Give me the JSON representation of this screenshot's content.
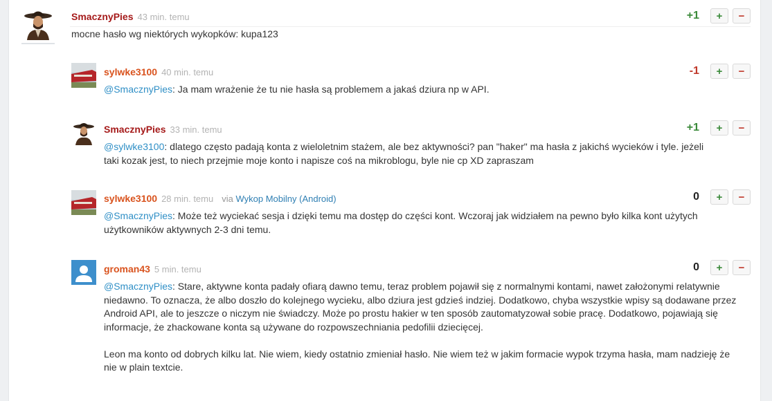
{
  "entry": {
    "author": "SmacznyPies",
    "time": "43 min. temu",
    "score": "+1",
    "text": "mocne hasło wg niektórych wykopków: kupa123",
    "plus_label": "+",
    "minus_label": "−"
  },
  "comments": [
    {
      "author": "sylwke3100",
      "time": "40 min. temu",
      "score": "-1",
      "mention": "@SmacznyPies",
      "text": ": Ja mam wrażenie że tu nie hasła są problemem a jakaś dziura np w API.",
      "plus_label": "+",
      "minus_label": "−"
    },
    {
      "author": "SmacznyPies",
      "time": "33 min. temu",
      "score": "+1",
      "mention": "@sylwke3100",
      "text": ": dlatego często padają konta z wieloletnim stażem, ale bez aktywności? pan \"haker\" ma hasła z jakichś wycieków i tyle. jeżeli taki kozak jest, to niech przejmie moje konto i napisze coś na mikroblogu, byle nie cp XD zapraszam",
      "plus_label": "+",
      "minus_label": "−"
    },
    {
      "author": "sylwke3100",
      "time": "28 min. temu",
      "via_prefix": "via",
      "via_app": "Wykop Mobilny (Android)",
      "score": "0",
      "mention": "@SmacznyPies",
      "text": ": Może też wyciekać sesja i dzięki temu ma dostęp do części kont. Wczoraj jak widziałem na pewno było kilka kont użytych użytkowników aktywnych 2-3 dni temu.",
      "plus_label": "+",
      "minus_label": "−"
    },
    {
      "author": "groman43",
      "time": "5 min. temu",
      "score": "0",
      "mention": "@SmacznyPies",
      "text": ": Stare, aktywne konta padały ofiarą dawno temu, teraz problem pojawił się z normalnymi kontami, nawet założonymi relatywnie niedawno. To oznacza, że albo doszło do kolejnego wycieku, albo dziura jest gdzieś indziej. Dodatkowo, chyba wszystkie wpisy są dodawane przez Android API, ale to jeszcze o niczym nie świadczy. Może po prostu hakier w ten sposób zautomatyzował sobie pracę. Dodatkowo, pojawiają się informacje, że zhackowane konta są używane do rozpowszechniania pedofilii dziecięcej.",
      "text2": "Leon ma konto od dobrych kilku lat. Nie wiem, kiedy ostatnio zmieniał hasło. Nie wiem też w jakim formacie wypok trzyma hasła, mam nadzieję że nie w plain textcie.",
      "plus_label": "+",
      "minus_label": "−"
    }
  ],
  "colors": {
    "author_red": "#a51a1a",
    "author_orange": "#d9531e",
    "positive": "#3b8a3a",
    "negative": "#c0392b",
    "link": "#2f8fc6"
  }
}
